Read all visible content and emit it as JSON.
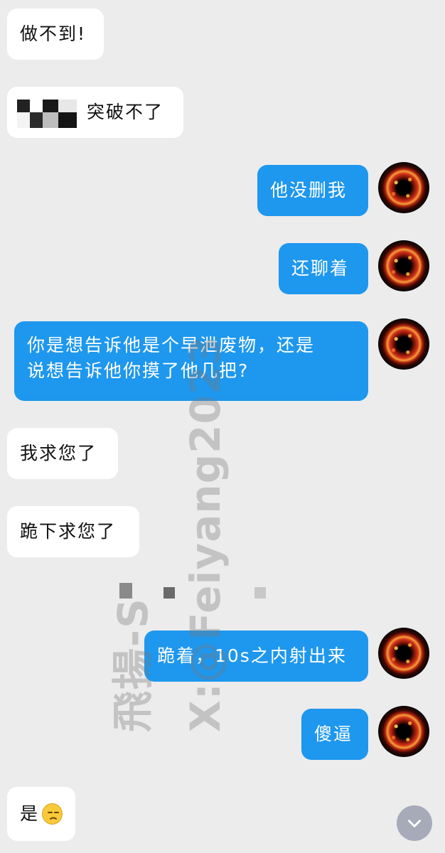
{
  "messages": {
    "m1": "做不到!",
    "m2": "突破不了",
    "m3": "他没删我",
    "m4": "还聊着",
    "m5_line1": "你是想告诉他是个早泄废物，还是",
    "m5_line2": "说想告诉他你摸了他几把?",
    "m6": "我求您了",
    "m7": "跪下求您了",
    "m8": "跪着，10s之内射出来",
    "m9": "傻逼",
    "m10": "是"
  },
  "icons": {
    "scroll_down": "chevron-down-icon",
    "emoji": "unamused-face-emoji"
  },
  "watermark": {
    "line1": "飛揚-S",
    "line2": "X:@Feiyang2023"
  },
  "colors": {
    "outgoing_bubble": "#1e97ee",
    "incoming_bubble": "#ffffff",
    "background": "#ececec"
  }
}
